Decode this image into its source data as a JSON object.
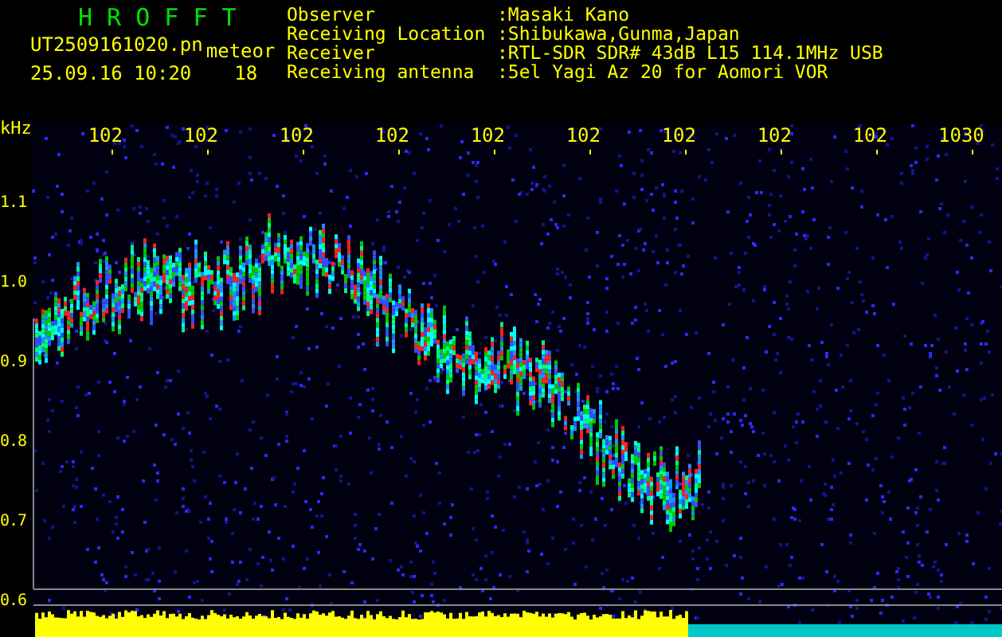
{
  "header": {
    "title": "H R O F F T",
    "file_name": "UT2509161020.pn",
    "mode": "meteor",
    "timestamp": "25.09.16 10:20",
    "count": "18"
  },
  "info": [
    {
      "label": "Observer",
      "value": ":Masaki Kano"
    },
    {
      "label": "Receiving Location",
      "value": ":Shibukawa,Gunma,Japan"
    },
    {
      "label": "Receiver",
      "value": ":RTL-SDR SDR# 43dB L15 114.1MHz USB"
    },
    {
      "label": "Receiving antenna",
      "value": ":5el Yagi Az 20 for Aomori VOR"
    }
  ],
  "plot": {
    "y_unit": "kHz",
    "y_labels": [
      "1.1",
      "1.0",
      "0.9",
      "0.8",
      "0.7",
      "0.6"
    ],
    "time_labels": [
      "102",
      "102",
      "102",
      "102",
      "102",
      "102",
      "102",
      "102",
      "102",
      "1030"
    ]
  }
}
